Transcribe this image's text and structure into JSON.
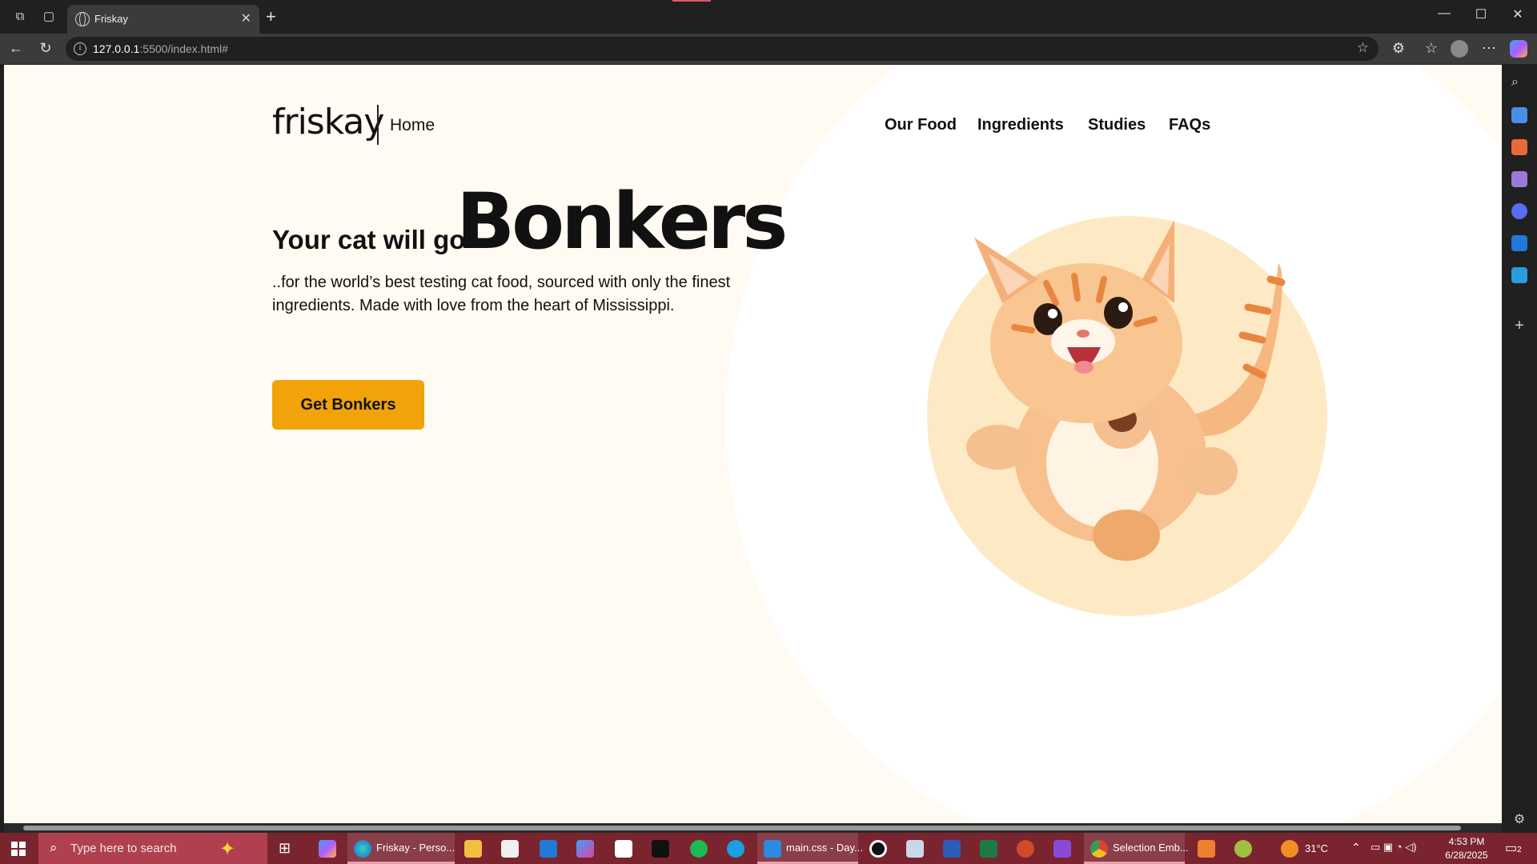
{
  "browser": {
    "tab_title": "Friskay",
    "url_host": "127.0.0.1",
    "url_rest": ":5500/index.html#"
  },
  "page": {
    "logo": "friskay",
    "home_link": "Home",
    "nav": [
      "Our Food",
      "Ingredients",
      "Studies",
      "FAQs"
    ],
    "hero_prefix": "Your cat will go",
    "hero_big": "Bonkers",
    "description": "..for the world’s best testing cat food, sourced with only the finest ingredients. Made with love from the heart of Mississippi.",
    "cta_label": "Get Bonkers",
    "colors": {
      "background": "#fffaf2",
      "accent": "#f2a30a",
      "cat_circle": "#fde9c4"
    }
  },
  "taskbar": {
    "search_placeholder": "Type here to search",
    "edge_app_label": "Friskay - Perso...",
    "vscode_label": "main.css - Day...",
    "chrome_label": "Selection Emb...",
    "weather": "31°C",
    "time": "4:53 PM",
    "date": "6/28/2025",
    "notifications": "2"
  }
}
